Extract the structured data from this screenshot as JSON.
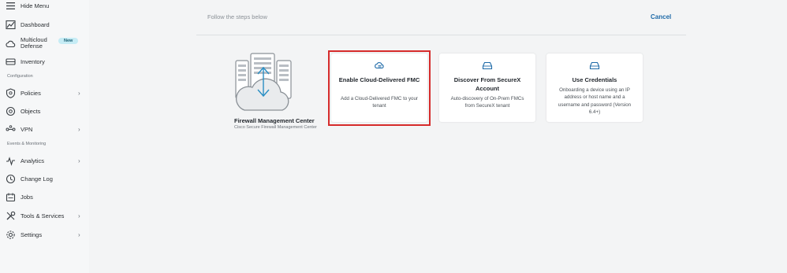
{
  "sidebar": {
    "hide_menu": "Hide Menu",
    "items": [
      {
        "label": "Dashboard"
      },
      {
        "label": "Multicloud",
        "label2": "Defense",
        "badge": "New"
      },
      {
        "label": "Inventory"
      },
      {
        "label": "Policies"
      },
      {
        "label": "Objects"
      },
      {
        "label": "VPN"
      },
      {
        "label": "Analytics"
      },
      {
        "label": "Change Log"
      },
      {
        "label": "Jobs"
      },
      {
        "label": "Tools & Services"
      },
      {
        "label": "Settings"
      }
    ],
    "sections": {
      "configuration": "Configuration",
      "events": "Events & Monitoring"
    }
  },
  "main": {
    "header_text": "Follow the steps below",
    "cancel_label": "Cancel",
    "fmc": {
      "title": "Firewall Management Center",
      "subtitle": "Cisco Secure Firewall Management Center"
    },
    "cards": [
      {
        "title": "Enable Cloud-Delivered FMC",
        "description": "Add a Cloud-Delivered FMC to your tenant",
        "icon": "cloud-fmc-icon",
        "selected": true
      },
      {
        "title": "Discover From SecureX Account",
        "description": "Auto-discovery of On-Prem FMCs from SecureX tenant",
        "icon": "device-icon"
      },
      {
        "title": "Use Credentials",
        "description": "Onboarding a device using an IP address or host name and a username and password (Version 6.4+)",
        "icon": "device-icon"
      }
    ]
  },
  "colors": {
    "accent": "#1e6aa8",
    "highlight": "#d62b2b",
    "badge_bg": "#c6ecf5"
  }
}
